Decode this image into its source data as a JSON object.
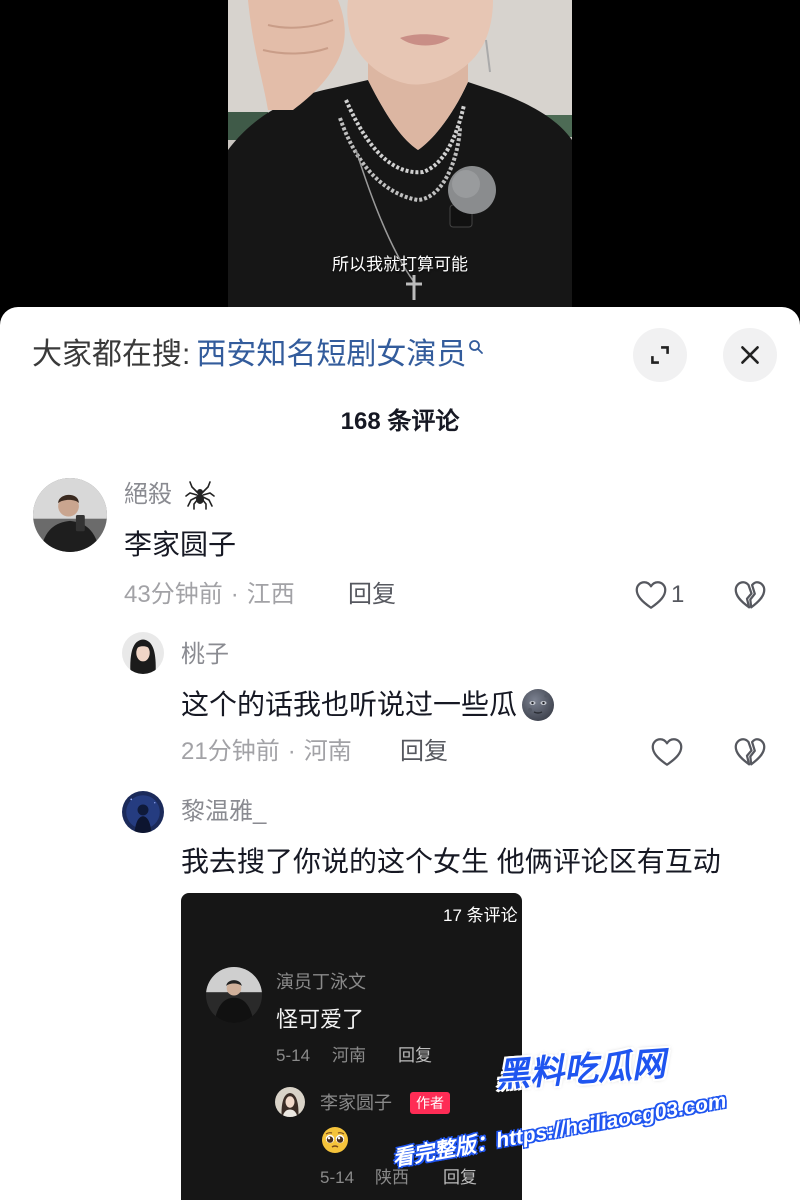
{
  "video": {
    "subtitle": "所以我就打算可能"
  },
  "search_banner": {
    "prefix": "大家都在搜:",
    "query": "西安知名短剧女演员",
    "icon": "search-icon"
  },
  "panel": {
    "title": "168 条评论",
    "expand_icon": "expand-icon",
    "close_icon": "close-icon"
  },
  "meta_separator": "·",
  "comment": {
    "username": "絕殺",
    "username_emoji": "spider-emoji",
    "text": "李家圆子",
    "time": "43分钟前",
    "location": "江西",
    "reply_label": "回复",
    "like_count": "1",
    "like_icon": "heart-outline-icon",
    "dislike_icon": "broken-heart-icon"
  },
  "replies": [
    {
      "username": "桃子",
      "text": "这个的话我也听说过一些瓜",
      "text_emoji": "new-moon-face-emoji",
      "time": "21分钟前",
      "location": "河南",
      "reply_label": "回复",
      "like_icon": "heart-outline-icon",
      "dislike_icon": "broken-heart-icon"
    },
    {
      "username": "黎温雅_",
      "text": "我去搜了你说的这个女生 他俩评论区有互动",
      "attached_screenshot": {
        "title": "17 条评论",
        "comment": {
          "username": "演员丁泳文",
          "text": "怪可爱了",
          "date": "5-14",
          "location": "河南",
          "reply_label": "回复"
        },
        "reply": {
          "username": "李家圆子",
          "badge": "作者",
          "text_emoji": "pleading-face-emoji",
          "date": "5-14",
          "location": "陕西",
          "reply_label": "回复"
        }
      }
    }
  ],
  "watermark": {
    "brand": "黑料吃瓜网",
    "link_text": "看完整版：https://heiliaocg03.com"
  },
  "colors": {
    "trending_query_blue": "#335c9c",
    "author_badge_red": "#fe2c55",
    "watermark_blue": "#1f55f0",
    "panel_background": "#ffffff",
    "video_background": "#000000"
  }
}
